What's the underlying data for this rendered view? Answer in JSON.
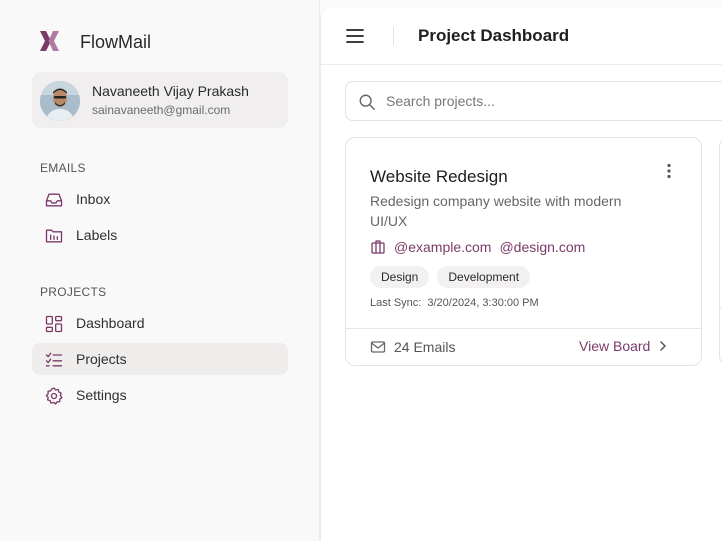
{
  "app": {
    "name": "FlowMail",
    "accent": "#7b3b6a"
  },
  "profile": {
    "name": "Navaneeth Vijay Prakash",
    "email": "sainavaneeth@gmail.com"
  },
  "sidebar": {
    "sections": [
      {
        "label": "EMAILS",
        "items": [
          {
            "label": "Inbox",
            "icon": "inbox-icon"
          },
          {
            "label": "Labels",
            "icon": "folder-icon"
          }
        ]
      },
      {
        "label": "PROJECTS",
        "items": [
          {
            "label": "Dashboard",
            "icon": "dashboard-icon"
          },
          {
            "label": "Projects",
            "icon": "list-check-icon",
            "active": true
          },
          {
            "label": "Settings",
            "icon": "gear-icon"
          }
        ]
      }
    ]
  },
  "header": {
    "title": "Project Dashboard"
  },
  "search": {
    "placeholder": "Search projects..."
  },
  "projects": [
    {
      "title": "Website Redesign",
      "description": "Redesign company website with modern UI/UX",
      "domains": [
        "@example.com",
        "@design.com"
      ],
      "tags": [
        "Design",
        "Development"
      ],
      "last_sync_label": "Last Sync:",
      "last_sync": "3/20/2024, 3:30:00 PM",
      "emails": "24 Emails",
      "view_board": "View Board"
    }
  ]
}
